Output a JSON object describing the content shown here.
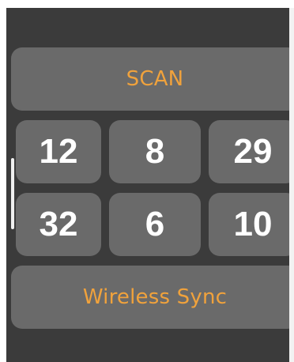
{
  "buttons": {
    "scan_label": "SCAN",
    "wireless_sync_label": "Wireless Sync"
  },
  "grid": {
    "cells": [
      "12",
      "8",
      "29",
      "32",
      "6",
      "10"
    ]
  },
  "colors": {
    "background": "#3b3b3b",
    "button": "#6a6a6a",
    "accent": "#f0a23c",
    "number_text": "#ffffff"
  }
}
